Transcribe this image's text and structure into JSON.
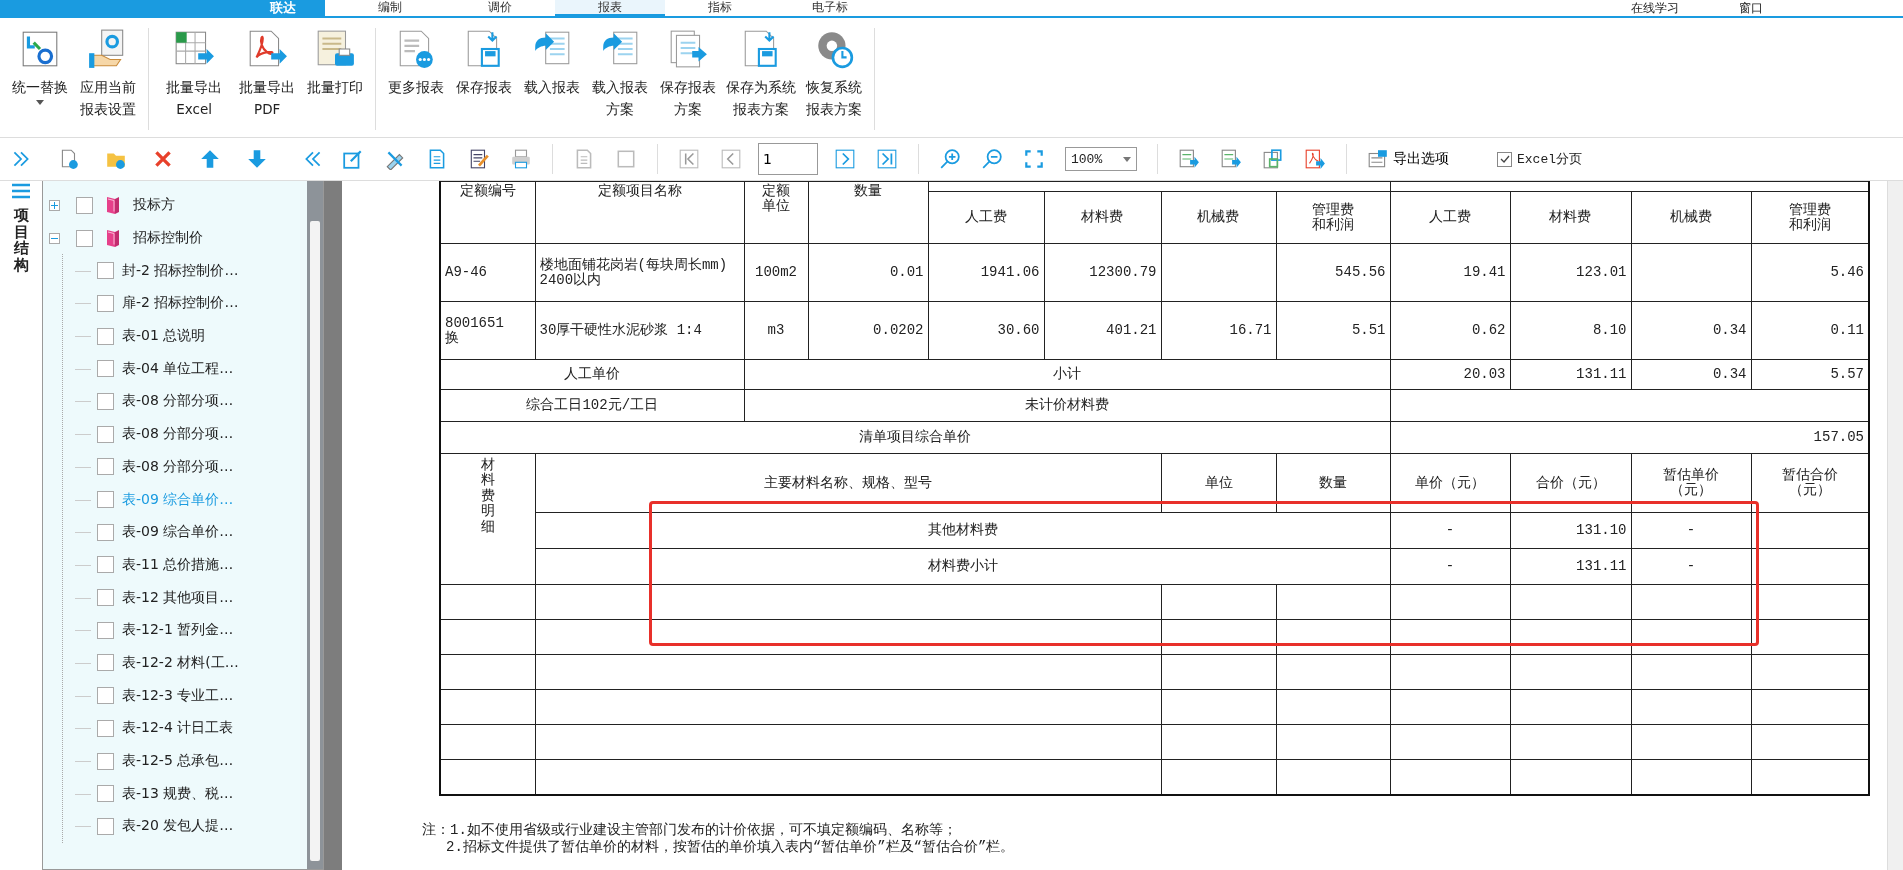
{
  "top_bar": {
    "logo": "联达",
    "tabs": [
      {
        "label": "编制",
        "selected": false
      },
      {
        "label": "调价",
        "selected": false
      },
      {
        "label": "报表",
        "selected": true
      },
      {
        "label": "指标",
        "selected": false
      },
      {
        "label": "电子标",
        "selected": false
      }
    ],
    "links": [
      "在线学习",
      "窗口"
    ]
  },
  "ribbon": {
    "groups": [
      [
        {
          "kind": "replace",
          "label": "统一替换",
          "dropdown": true
        },
        {
          "kind": "apply",
          "label": "应用当前报表设置",
          "dropdown": false
        }
      ],
      [
        {
          "kind": "excel",
          "label": "批量导出Excel",
          "dropdown": false
        },
        {
          "kind": "pdf",
          "label": "批量导出PDF",
          "dropdown": false
        },
        {
          "kind": "print",
          "label": "批量打印",
          "dropdown": false
        }
      ],
      [
        {
          "kind": "more",
          "label": "更多报表",
          "dropdown": false
        },
        {
          "kind": "save",
          "label": "保存报表",
          "dropdown": false
        },
        {
          "kind": "load",
          "label": "载入报表",
          "dropdown": false
        },
        {
          "kind": "load-scheme",
          "label": "载入报表方案",
          "dropdown": false
        },
        {
          "kind": "save-scheme",
          "label": "保存报表方案",
          "dropdown": false
        },
        {
          "kind": "save-system",
          "label": "保存为系统报表方案",
          "dropdown": false
        },
        {
          "kind": "restore",
          "label": "恢复系统报表方案",
          "dropdown": false
        }
      ]
    ]
  },
  "toolbar": {
    "page": "1",
    "zoom": "100%",
    "export_options": "导出选项",
    "excel_paging": {
      "label": "Excel分页",
      "checked": true
    }
  },
  "sidebar": {
    "title": "项目结构",
    "tree": [
      {
        "label": "投标方",
        "expanded": false,
        "checked": false,
        "selected": false
      },
      {
        "label": "招标控制价",
        "expanded": true,
        "checked": false,
        "selected": false,
        "children": [
          {
            "label": "封-2 招标控制价…",
            "checked": false,
            "selected": false
          },
          {
            "label": "扉-2 招标控制价…",
            "checked": false,
            "selected": false
          },
          {
            "label": "表-01 总说明",
            "checked": false,
            "selected": false
          },
          {
            "label": "表-04 单位工程…",
            "checked": false,
            "selected": false
          },
          {
            "label": "表-08 分部分项…",
            "checked": false,
            "selected": false
          },
          {
            "label": "表-08 分部分项…",
            "checked": false,
            "selected": false
          },
          {
            "label": "表-08 分部分项…",
            "checked": false,
            "selected": false
          },
          {
            "label": "表-09 综合单价…",
            "checked": false,
            "selected": true
          },
          {
            "label": "表-09 综合单价…",
            "checked": false,
            "selected": false
          },
          {
            "label": "表-11 总价措施…",
            "checked": false,
            "selected": false
          },
          {
            "label": "表-12 其他项目…",
            "checked": false,
            "selected": false
          },
          {
            "label": "表-12-1 暂列金…",
            "checked": false,
            "selected": false
          },
          {
            "label": "表-12-2 材料(工…",
            "checked": false,
            "selected": false
          },
          {
            "label": "表-12-3 专业工…",
            "checked": false,
            "selected": false
          },
          {
            "label": "表-12-4 计日工表",
            "checked": false,
            "selected": false
          },
          {
            "label": "表-12-5 总承包…",
            "checked": false,
            "selected": false
          },
          {
            "label": "表-13 规费、税…",
            "checked": false,
            "selected": false
          },
          {
            "label": "表-20 发包人提…",
            "checked": false,
            "selected": false
          }
        ]
      }
    ]
  },
  "report": {
    "columns": [
      "定额编号",
      "定额项目名称",
      "定额单位",
      "数量"
    ],
    "unit_price_columns": [
      "人工费",
      "材料费",
      "机械费",
      "管理费和利润"
    ],
    "total_price_columns": [
      "人工费",
      "材料费",
      "机械费",
      "管理费和利润"
    ],
    "items": [
      {
        "code": "A9-46",
        "name": "楼地面铺花岗岩(每块周长mm) 2400以内",
        "unit": "100m2",
        "quantity": "0.01",
        "unit_prices": {
          "labor": "1941.06",
          "material": "12300.79",
          "overhead": "545.56"
        },
        "totals": {
          "labor": "19.41",
          "material": "123.01",
          "overhead": "5.46"
        }
      },
      {
        "code": "8001651换",
        "name": "30厚干硬性水泥砂浆 1:4",
        "unit": "m3",
        "quantity": "0.0202",
        "unit_prices": {
          "labor": "30.60",
          "material": "401.21",
          "machine": "16.71",
          "overhead": "5.51"
        },
        "totals": {
          "labor": "0.62",
          "material": "8.10",
          "machine": "0.34",
          "overhead": "0.11"
        }
      }
    ],
    "labor_price_label": "人工单价",
    "subtotal_label": "小计",
    "subtotals": [
      "20.03",
      "131.11",
      "0.34",
      "5.57"
    ],
    "labor_rate": "综合工日102元/工日",
    "unpriced_label": "未计价材料费",
    "composite_label": "清单项目综合单价",
    "composite_value": "157.05",
    "materials": {
      "title": "材料费明细",
      "columns": [
        "主要材料名称、规格、型号",
        "单位",
        "数量",
        "单价（元）",
        "合价（元）",
        "暂估单价（元）",
        "暂估合价（元）"
      ],
      "rows": [
        {
          "name": "其他材料费",
          "unit_price": "-",
          "amount": "131.10",
          "estimated_unit_price": "-"
        },
        {
          "name": "材料费小计",
          "unit_price": "-",
          "amount": "131.11",
          "estimated_unit_price": "-"
        }
      ]
    },
    "notes": [
      "注：1.如不使用省级或行业建设主管部门发布的计价依据，可不填定额编码、名称等；",
      "2.招标文件提供了暂估单价的材料，按暂估的单价填入表内“暂估单价”栏及“暂估合价”栏。"
    ]
  }
}
